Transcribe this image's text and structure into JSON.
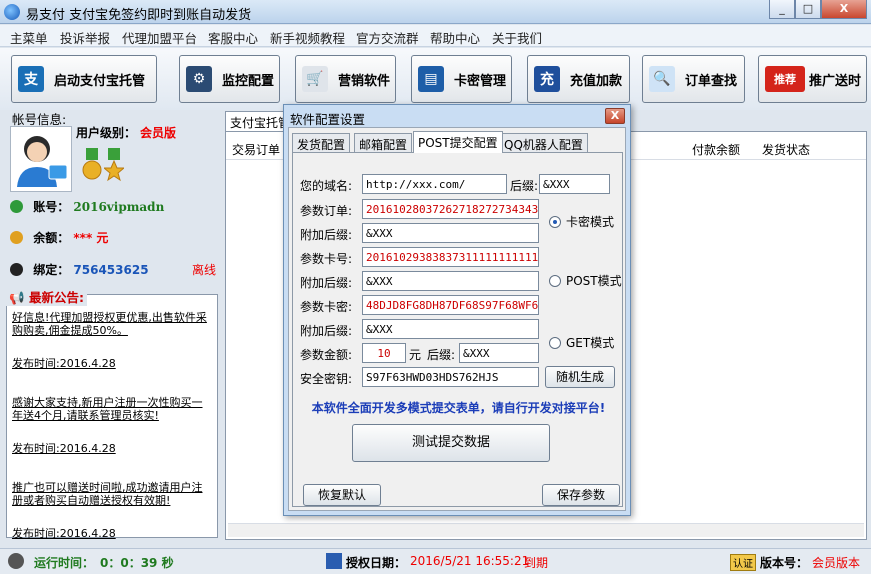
{
  "window": {
    "title": "易支付  支付宝免签约即时到账自动发货",
    "min": "_",
    "max": "□",
    "close": "X"
  },
  "menu": [
    "主菜单",
    "投诉举报",
    "代理加盟平台",
    "客服中心",
    "新手视频教程",
    "官方交流群",
    "帮助中心",
    "关于我们"
  ],
  "toolbar": [
    {
      "label": "启动支付宝托管",
      "icon": "alipay-icon",
      "glyph": "支",
      "color": "#1a6fb6"
    },
    {
      "label": "监控配置",
      "icon": "gear-icon",
      "glyph": "⚙",
      "color": "#2b4b73"
    },
    {
      "label": "营销软件",
      "icon": "cart-icon",
      "glyph": "🛒",
      "color": "#3a3a3a"
    },
    {
      "label": "卡密管理",
      "icon": "card-icon",
      "glyph": "▤",
      "color": "#1e5ea8"
    },
    {
      "label": "充值加款",
      "icon": "recharge-icon",
      "glyph": "充",
      "color": "#1f4f9c"
    },
    {
      "label": "订单查找",
      "icon": "magnifier-icon",
      "glyph": "🔍",
      "color": "#2f82c9"
    },
    {
      "label": "推广送时",
      "icon": "promote-icon",
      "glyph": "推荐",
      "color": "#d4241a"
    }
  ],
  "account": {
    "info_title": "帐号信息:",
    "level_label": "用户级别：",
    "level_value": "会员版",
    "account_label": "账号：",
    "account_value": "2016vipmadn",
    "balance_label": "余额：",
    "balance_value": "***",
    "balance_unit": "元",
    "bind_label": "绑定：",
    "bind_value": "756453625",
    "status": "离线"
  },
  "notice": {
    "title": "最新公告:",
    "items": [
      {
        "text": "好信息!代理加盟授权更优惠,出售软件采购购卖,佣金提成50%。",
        "date": "发布时间:2016.4.28"
      },
      {
        "text": "感谢大家支持,新用户注册一次性购买一年送4个月,请联系管理员核实!",
        "date": "发布时间:2016.4.28"
      },
      {
        "text": "推广也可以赠送时间啦,成功邀请用户注册或者购买自动赠送授权有效期!",
        "date": "发布时间:2016.4.28"
      }
    ]
  },
  "main": {
    "tab_label": "支付宝托管",
    "columns": [
      "交易订单",
      "付款余额",
      "发货状态"
    ]
  },
  "dialog": {
    "title": "软件配置设置",
    "close": "X",
    "tabs": [
      "发货配置",
      "邮箱配置",
      "POST提交配置",
      "QQ机器人配置"
    ],
    "active_tab": "POST提交配置",
    "domain_label": "您的域名:",
    "domain_value": "http://xxx.com/",
    "suffix_label": "后缀:",
    "suffix_value": "&XXX",
    "order_label": "参数订单:",
    "order_value": "20161028037262718272734343",
    "extra_label_1": "附加后缀:",
    "extra_value_1": "&XXX",
    "card_label": "参数卡号:",
    "card_value": "20161029383837311111111111",
    "extra_label_2": "附加后缀:",
    "extra_value_2": "&XXX",
    "secret_label": "参数卡密:",
    "secret_value": "48DJD8FG8DH87DF68S97F68WF60",
    "extra_label_3": "附加后缀:",
    "extra_value_3": "&XXX",
    "amount_label": "参数金额:",
    "amount_value": "10",
    "amount_unit": "元",
    "amount_suffix_label": "后缀:",
    "amount_suffix_value": "&XXX",
    "key_label": "安全密钥:",
    "key_value": "S97F63HWD03HDS762HJS",
    "random_btn": "随机生成",
    "modes": [
      {
        "label": "卡密模式",
        "checked": true
      },
      {
        "label": "POST模式",
        "checked": false
      },
      {
        "label": "GET模式",
        "checked": false
      }
    ],
    "hint": "本软件全面开发多模式提交表单，请自行开发对接平台!",
    "test_btn": "测试提交数据",
    "reset_btn": "恢复默认",
    "save_btn": "保存参数"
  },
  "status": {
    "runtime_label": "运行时间：",
    "runtime_value": "0：0：39 秒",
    "auth_label": "授权日期：",
    "auth_value": "2016/5/21 16:55:21",
    "auth_suffix": "到期",
    "version_label": "版本号：",
    "version_value": "会员版本",
    "badge": "认证"
  }
}
